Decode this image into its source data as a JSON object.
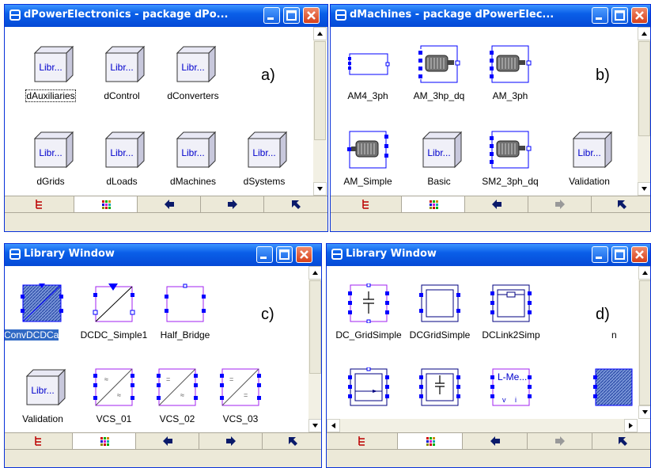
{
  "colors": {
    "title_bar": "#0a5fe8",
    "selection": "#316ac5",
    "component_blue": "#0000ff",
    "component_purple": "#a020f0"
  },
  "windows": {
    "a": {
      "title": "dPowerElectronics - package dPo...",
      "panel_label": "a)",
      "items": [
        {
          "label": "dAuxiliaries",
          "icon": "library-box-icon",
          "icon_text": "Libr..."
        },
        {
          "label": "dControl",
          "icon": "library-box-icon",
          "icon_text": "Libr..."
        },
        {
          "label": "dConverters",
          "icon": "library-box-icon",
          "icon_text": "Libr..."
        },
        {
          "label": "dGrids",
          "icon": "library-box-icon",
          "icon_text": "Libr..."
        },
        {
          "label": "dLoads",
          "icon": "library-box-icon",
          "icon_text": "Libr..."
        },
        {
          "label": "dMachines",
          "icon": "library-box-icon",
          "icon_text": "Libr..."
        },
        {
          "label": "dSystems",
          "icon": "library-box-icon",
          "icon_text": "Libr..."
        }
      ]
    },
    "b": {
      "title": "dMachines - package dPowerElec...",
      "panel_label": "b)",
      "items": [
        {
          "label": "AM4_3ph",
          "icon": "machine-block-icon"
        },
        {
          "label": "AM_3hp_dq",
          "icon": "motor-icon"
        },
        {
          "label": "AM_3ph",
          "icon": "motor-icon"
        },
        {
          "label": "AM_Simple",
          "icon": "motor-icon"
        },
        {
          "label": "Basic",
          "icon": "library-box-icon",
          "icon_text": "Libr..."
        },
        {
          "label": "SM2_3ph_dq",
          "icon": "motor-icon"
        },
        {
          "label": "Validation",
          "icon": "library-box-icon",
          "icon_text": "Libr..."
        }
      ]
    },
    "c": {
      "title": "Library Window",
      "panel_label": "c)",
      "items": [
        {
          "label": "ConvDCDCa",
          "icon": "converter-hatched-icon"
        },
        {
          "label": "DCDC_Simple1",
          "icon": "dcdc-converter-icon"
        },
        {
          "label": "Half_Bridge",
          "icon": "half-bridge-icon"
        },
        {
          "label": "Validation",
          "icon": "library-box-icon",
          "icon_text": "Libr..."
        },
        {
          "label": "VCS_01",
          "icon": "vcs-icon"
        },
        {
          "label": "VCS_02",
          "icon": "vcs-icon"
        },
        {
          "label": "VCS_03",
          "icon": "vcs-icon"
        }
      ]
    },
    "d": {
      "title": "Library Window",
      "panel_label": "d)",
      "items": [
        {
          "label": "DC_GridSimple",
          "icon": "capacitor-grid-icon"
        },
        {
          "label": "DCGridSimple",
          "icon": "dc-grid-icon"
        },
        {
          "label": "DCLink2Simp",
          "icon": "dc-link-icon"
        },
        {
          "label": "n",
          "icon": ""
        },
        {
          "label": "",
          "icon": "dc-grid-arrow-icon"
        },
        {
          "label": "",
          "icon": "capacitor-box-icon"
        },
        {
          "label": "",
          "icon": "l-meas-icon",
          "icon_text": "L-Me..."
        },
        {
          "label": "",
          "icon": "hatched-block-icon"
        }
      ]
    }
  }
}
